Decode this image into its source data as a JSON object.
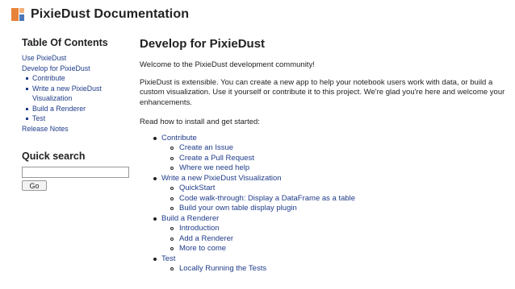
{
  "header": {
    "brand": "PixieDust Documentation",
    "logo_icon": "pixiedust-logo-icon"
  },
  "sidebar": {
    "toc_title": "Table Of Contents",
    "links": {
      "use": "Use PixieDust",
      "develop": "Develop for PixieDust",
      "contribute": "Contribute",
      "visualization": "Write a new PixieDust Visualization",
      "renderer": "Build a Renderer",
      "test": "Test",
      "release": "Release Notes"
    },
    "quick_search": {
      "title": "Quick search",
      "input_value": "",
      "button": "Go"
    }
  },
  "main": {
    "title": "Develop for PixieDust",
    "intro": "Welcome to the PixieDust development community!",
    "body": "PixieDust is extensible. You can create a new app to help your notebook users work with data, or build a custom visualization. Use it yourself or contribute it to this project. We're glad you're here and welcome your enhancements.",
    "read_how": "Read how to install and get started:",
    "topics": [
      {
        "label": "Contribute",
        "items": [
          "Create an Issue",
          "Create a Pull Request",
          "Where we need help"
        ]
      },
      {
        "label": "Write a new PixieDust Visualization",
        "items": [
          "QuickStart",
          "Code walk-through: Display a DataFrame as a table",
          "Build your own table display plugin"
        ]
      },
      {
        "label": "Build a Renderer",
        "items": [
          "Introduction",
          "Add a Renderer",
          "More to come"
        ]
      },
      {
        "label": "Test",
        "items": [
          "Locally Running the Tests"
        ]
      }
    ]
  }
}
